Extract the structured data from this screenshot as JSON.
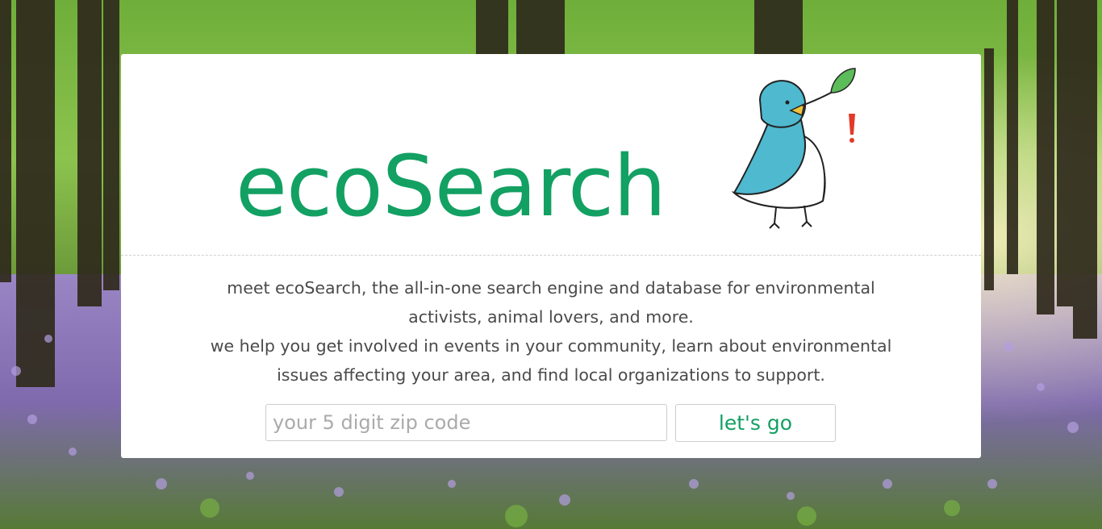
{
  "brand": {
    "title": "ecoSearch",
    "color": "#13a063",
    "mascot_icon": "bluebird-with-leaf-icon"
  },
  "intro": {
    "lines": [
      "meet ecoSearch, the all-in-one search engine and database for environmental",
      "activists, animal lovers, and more.",
      "we help you get involved in events in your community, learn about environmental",
      "issues affecting your area, and find local organizations to support."
    ]
  },
  "search": {
    "zip_placeholder": "your 5 digit zip code",
    "zip_value": "",
    "submit_label": "let's go"
  },
  "background": {
    "scene": "bluebell-forest-image",
    "colors": {
      "canopy": "#8cc34e",
      "trunks": "#2f2a1c",
      "bluebells": "#8a79b8"
    }
  }
}
